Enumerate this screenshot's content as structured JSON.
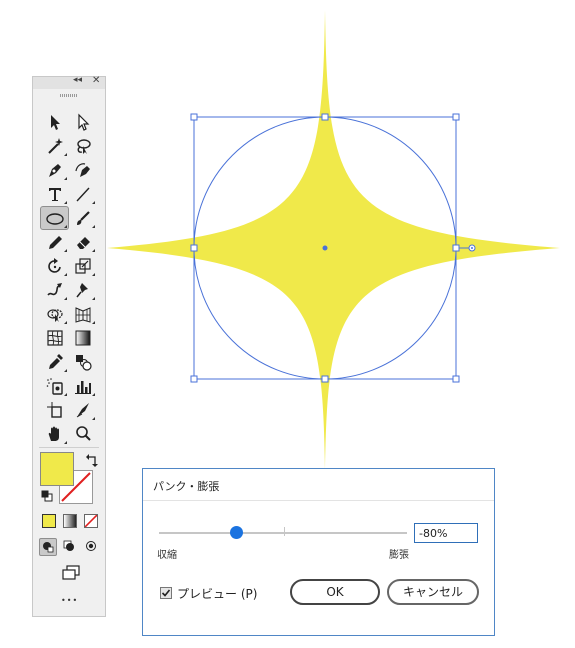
{
  "toolbar": {
    "collapse_icon": "double-chevron-left-icon",
    "close_icon": "close-icon",
    "more_label": "•••",
    "tools": [
      {
        "name": "selection-tool",
        "icon": "arrow-icon"
      },
      {
        "name": "direct-selection-tool",
        "icon": "hollow-arrow-icon"
      },
      {
        "name": "magic-wand-tool",
        "icon": "magic-wand-icon"
      },
      {
        "name": "lasso-tool",
        "icon": "lasso-icon"
      },
      {
        "name": "pen-tool",
        "icon": "pen-icon"
      },
      {
        "name": "curvature-tool",
        "icon": "curvature-pen-icon"
      },
      {
        "name": "type-tool",
        "icon": "type-icon",
        "glyph": "T"
      },
      {
        "name": "line-segment-tool",
        "icon": "line-icon"
      },
      {
        "name": "ellipse-tool",
        "icon": "ellipse-icon",
        "selected": true
      },
      {
        "name": "paintbrush-tool",
        "icon": "brush-icon"
      },
      {
        "name": "pencil-tool",
        "icon": "pencil-icon"
      },
      {
        "name": "eraser-tool",
        "icon": "eraser-icon"
      },
      {
        "name": "rotate-tool",
        "icon": "rotate-icon"
      },
      {
        "name": "scale-tool",
        "icon": "scale-icon"
      },
      {
        "name": "warp-tool",
        "icon": "warp-icon"
      },
      {
        "name": "puppet-warp-tool",
        "icon": "pin-icon"
      },
      {
        "name": "shape-builder-tool",
        "icon": "shape-builder-icon"
      },
      {
        "name": "perspective-grid-tool",
        "icon": "perspective-grid-icon"
      },
      {
        "name": "mesh-tool",
        "icon": "mesh-icon"
      },
      {
        "name": "gradient-tool",
        "icon": "gradient-icon"
      },
      {
        "name": "eyedropper-tool",
        "icon": "eyedropper-icon"
      },
      {
        "name": "blend-tool",
        "icon": "blend-icon"
      },
      {
        "name": "symbol-sprayer-tool",
        "icon": "symbol-sprayer-icon"
      },
      {
        "name": "column-graph-tool",
        "icon": "column-graph-icon"
      },
      {
        "name": "artboard-tool",
        "icon": "artboard-icon"
      },
      {
        "name": "slice-tool",
        "icon": "slice-icon"
      },
      {
        "name": "hand-tool",
        "icon": "hand-icon"
      },
      {
        "name": "zoom-tool",
        "icon": "zoom-icon"
      }
    ],
    "fill_color": "#f0e94a",
    "stroke": "none"
  },
  "artwork": {
    "shape": "pucker-star",
    "fill_color": "#f0e94a",
    "selection_color": "#4a72d8"
  },
  "dialog": {
    "title": "パンク・膨張",
    "slider_min_label": "収縮",
    "slider_max_label": "膨張",
    "value": "-80%",
    "value_percent": -80,
    "preview_label": "プレビュー (P)",
    "preview_checked": true,
    "ok_label": "OK",
    "cancel_label": "キャンセル"
  }
}
